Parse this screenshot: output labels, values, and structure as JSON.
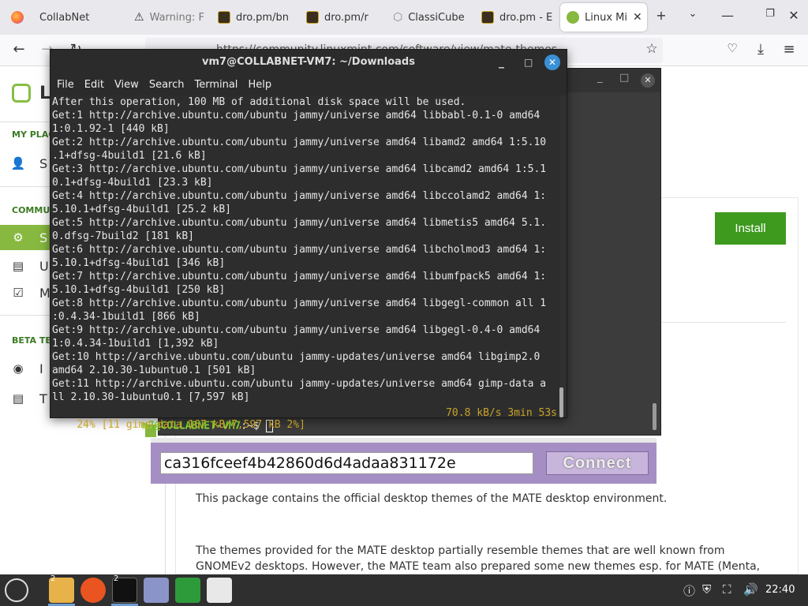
{
  "browser": {
    "tabs": [
      {
        "label": "CollabNet",
        "icon": "firefox-icon"
      },
      {
        "label": "Warning: F",
        "icon": "warning-icon"
      },
      {
        "label": "dro.pm/bn",
        "icon": "terminal-favicon"
      },
      {
        "label": "dro.pm/r",
        "icon": "terminal-favicon"
      },
      {
        "label": "ClassiCube",
        "icon": "cube-icon"
      },
      {
        "label": "dro.pm - E",
        "icon": "terminal-favicon"
      },
      {
        "label": "Linux Mi",
        "icon": "mint-icon",
        "active": true
      }
    ],
    "url": "https://community.linuxmint.com/software/view/mate-themes"
  },
  "page": {
    "logo_text": "Li",
    "sidebar": {
      "sections": [
        {
          "heading": "MY PLACE",
          "items": [
            {
              "label": "S",
              "icon": "person-icon"
            }
          ]
        },
        {
          "heading": "COMMUN",
          "items": [
            {
              "label": "S",
              "icon": "gears-icon",
              "active": true
            },
            {
              "label": "U",
              "icon": "id-card-icon"
            },
            {
              "label": "M",
              "icon": "check-icon"
            }
          ]
        },
        {
          "heading": "BETA TES",
          "items": [
            {
              "label": "I",
              "icon": "disc-icon"
            },
            {
              "label": "T",
              "icon": "id-card-icon"
            }
          ]
        }
      ]
    },
    "install_label": "Install",
    "description_1": "This package contains the official desktop themes of the MATE desktop environment.",
    "description_2": "The themes provided for the MATE desktop partially resemble themes that are well known from GNOMEv2 desktops. However, the MATE team also prepared some new themes esp. for MATE (Menta, GreenLaguna, TraditionalGreen,"
  },
  "back_terminal": {
    "prompt_user": "m7@COLLABNET-VM7",
    "prompt_path": ":~$ "
  },
  "connect_bar": {
    "session_id": "ca316fceef4b42860d6d4adaa831172e",
    "connect_label": "Connect"
  },
  "terminal": {
    "title": "vm7@COLLABNET-VM7: ~/Downloads",
    "menu": [
      "File",
      "Edit",
      "View",
      "Search",
      "Terminal",
      "Help"
    ],
    "lines": [
      "After this operation, 100 MB of additional disk space will be used.",
      "Get:1 http://archive.ubuntu.com/ubuntu jammy/universe amd64 libbabl-0.1-0 amd64",
      "1:0.1.92-1 [440 kB]",
      "Get:2 http://archive.ubuntu.com/ubuntu jammy/universe amd64 libamd2 amd64 1:5.10",
      ".1+dfsg-4build1 [21.6 kB]",
      "Get:3 http://archive.ubuntu.com/ubuntu jammy/universe amd64 libcamd2 amd64 1:5.1",
      "0.1+dfsg-4build1 [23.3 kB]",
      "Get:4 http://archive.ubuntu.com/ubuntu jammy/universe amd64 libccolamd2 amd64 1:",
      "5.10.1+dfsg-4build1 [25.2 kB]",
      "Get:5 http://archive.ubuntu.com/ubuntu jammy/universe amd64 libmetis5 amd64 5.1.",
      "0.dfsg-7build2 [181 kB]",
      "Get:6 http://archive.ubuntu.com/ubuntu jammy/universe amd64 libcholmod3 amd64 1:",
      "5.10.1+dfsg-4build1 [346 kB]",
      "Get:7 http://archive.ubuntu.com/ubuntu jammy/universe amd64 libumfpack5 amd64 1:",
      "5.10.1+dfsg-4build1 [250 kB]",
      "Get:8 http://archive.ubuntu.com/ubuntu jammy/universe amd64 libgegl-common all 1",
      ":0.4.34-1build1 [866 kB]",
      "Get:9 http://archive.ubuntu.com/ubuntu jammy/universe amd64 libgegl-0.4-0 amd64",
      "1:0.4.34-1build1 [1,392 kB]",
      "Get:10 http://archive.ubuntu.com/ubuntu jammy-updates/universe amd64 libgimp2.0",
      "amd64 2.10.30-1ubuntu0.1 [501 kB]",
      "Get:11 http://archive.ubuntu.com/ubuntu jammy-updates/universe amd64 gimp-data a",
      "ll 2.10.30-1ubuntu0.1 [7,597 kB]"
    ],
    "progress_left": "24% [11 gimp-data 167 kB/7,597 kB 2%]",
    "progress_right": "70.8 kB/s 3min 53s"
  },
  "taskbar": {
    "clock": "22:40",
    "badges": [
      "2",
      "2"
    ]
  },
  "colors": {
    "mint_green": "#87b83f",
    "install_green": "#3e9a1f",
    "connect_purple": "#a58ec3",
    "terminal_bg": "#2d2d2d",
    "progress_yellow": "#c9a227"
  }
}
